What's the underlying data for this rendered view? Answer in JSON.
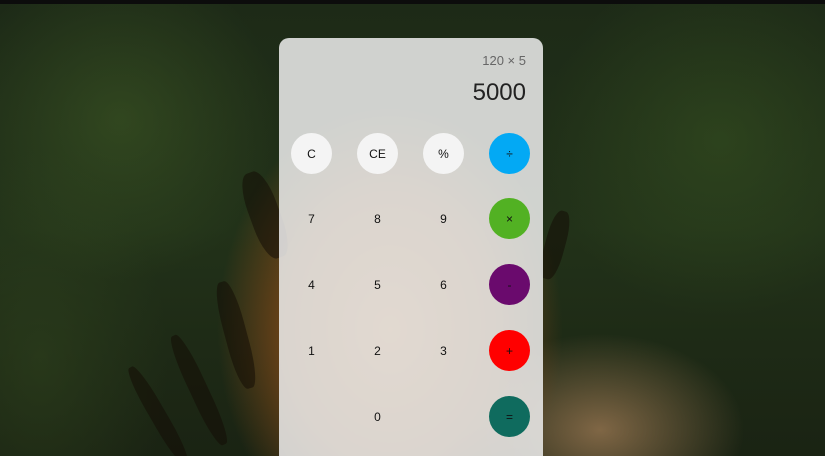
{
  "display": {
    "expression": "120 × 5",
    "result": "5000"
  },
  "keys": {
    "clear": "C",
    "clear_entry": "CE",
    "percent": "%",
    "divide": "÷",
    "seven": "7",
    "eight": "8",
    "nine": "9",
    "multiply": "×",
    "four": "4",
    "five": "5",
    "six": "6",
    "subtract": "-",
    "one": "1",
    "two": "2",
    "three": "3",
    "add": "+",
    "zero": "0",
    "equals": "="
  },
  "colors": {
    "divide": "#03a9f4",
    "multiply": "#52b123",
    "subtract": "#6a0a6d",
    "add": "#ff0000",
    "equals": "#0f6b5e"
  }
}
